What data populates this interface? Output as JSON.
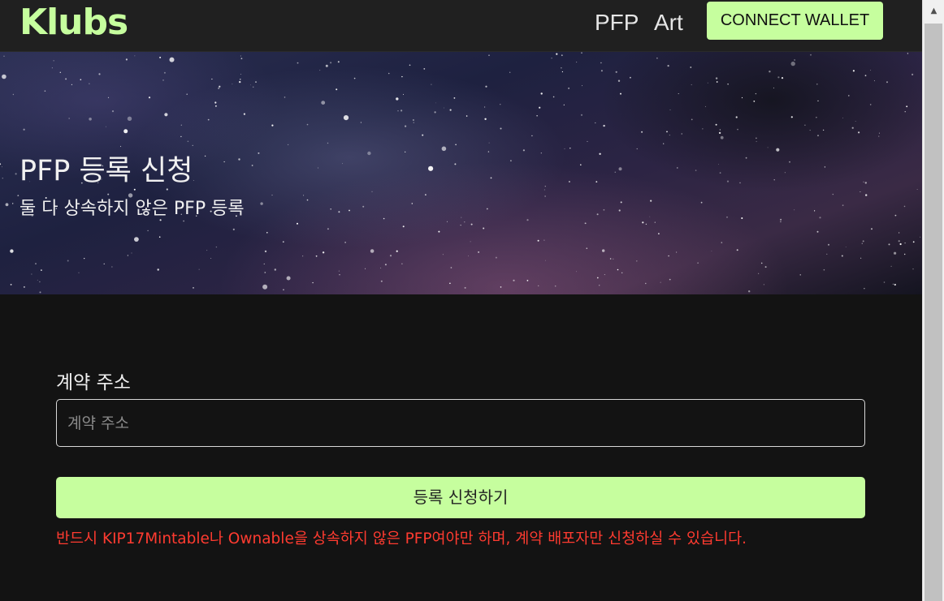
{
  "header": {
    "logo": "Klubs",
    "nav": [
      {
        "label": "PFP"
      },
      {
        "label": "Art"
      }
    ],
    "connect_label": "CONNECT WALLET"
  },
  "hero": {
    "title": "PFP 등록 신청",
    "subtitle": "둘 다 상속하지 않은 PFP 등록"
  },
  "form": {
    "contract_label": "계약 주소",
    "contract_placeholder": "계약 주소",
    "contract_value": "",
    "submit_label": "등록 신청하기",
    "warning": "반드시 KIP17Mintable나 Ownable을 상속하지 않은 PFP여야만 하며, 계약 배포자만 신청하실 수 있습니다."
  },
  "colors": {
    "accent": "#c6fe9e",
    "background": "#131313",
    "header_bg": "#202020",
    "warning": "#ff3b30"
  },
  "icons": {
    "scroll_up": "triangle-up-icon"
  }
}
